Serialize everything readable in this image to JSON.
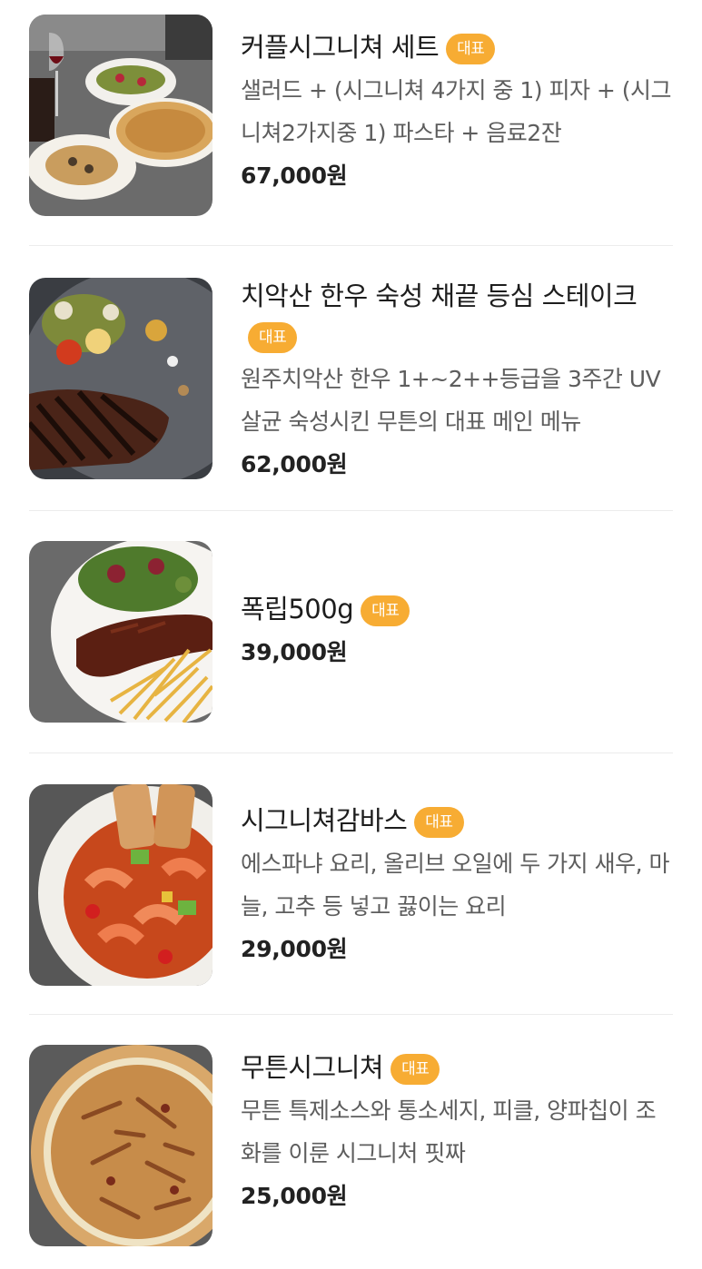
{
  "badge_color": "#f7ac33",
  "menu": [
    {
      "name": "커플시그니쳐 세트",
      "badge": "대표",
      "description": "샐러드 + (시그니쳐 4가지 중 1) 피자 + (시그니쳐2가지중 1) 파스타 + 음료2잔",
      "price": "67,000원",
      "image": "couple-set-photo"
    },
    {
      "name": "치악산 한우 숙성 채끝 등심 스테이크",
      "badge": "대표",
      "description": "원주치악산 한우 1+~2++등급을 3주간 UV살균 숙성시킨 무튼의 대표 메인 메뉴",
      "price": "62,000원",
      "image": "steak-photo"
    },
    {
      "name": "폭립500g",
      "badge": "대표",
      "description": "",
      "price": "39,000원",
      "image": "pork-ribs-photo"
    },
    {
      "name": "시그니쳐감바스",
      "badge": "대표",
      "description": "에스파냐 요리, 올리브 오일에 두 가지 새우, 마늘, 고추 등 넣고 끓이는 요리",
      "price": "29,000원",
      "image": "gambas-photo"
    },
    {
      "name": "무튼시그니쳐",
      "badge": "대표",
      "description": "무튼 특제소스와 통소세지, 피클, 양파칩이 조화를 이룬 시그니처 핏짜",
      "price": "25,000원",
      "image": "signature-pizza-photo"
    }
  ]
}
